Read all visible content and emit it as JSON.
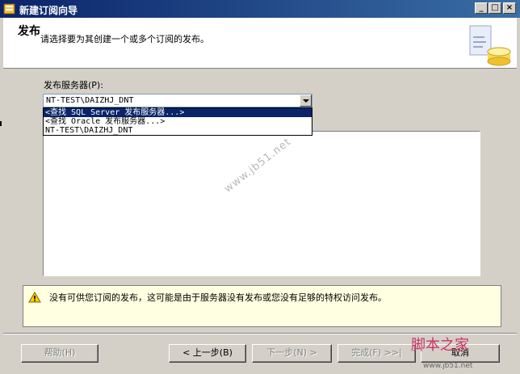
{
  "window": {
    "title": "新建订阅向导",
    "controls": [
      "_",
      "□",
      "×"
    ]
  },
  "header": {
    "title": "发布",
    "subtitle": "请选择要为其创建一个或多个订阅的发布。"
  },
  "publisher": {
    "label": "发布服务器(P):",
    "selected": "NT-TEST\\DAIZHJ_DNT",
    "options": [
      "<查找 SQL Server 发布服务器...>",
      "<查找 Oracle 发布服务器...>",
      "NT-TEST\\DAIZHJ_DNT"
    ]
  },
  "watermark": "www.jb51.net",
  "message": {
    "text": "没有可供您订阅的发布，这可能是由于服务器没有发布或您没有足够的特权访问发布。"
  },
  "buttons": {
    "help": "帮助(H)",
    "back": "< 上一步(B)",
    "next": "下一步(N) >",
    "finish": "完成(F) >>|",
    "cancel": "取消"
  },
  "brand": {
    "name": "脚本之家",
    "url": "www.jb51.net"
  }
}
